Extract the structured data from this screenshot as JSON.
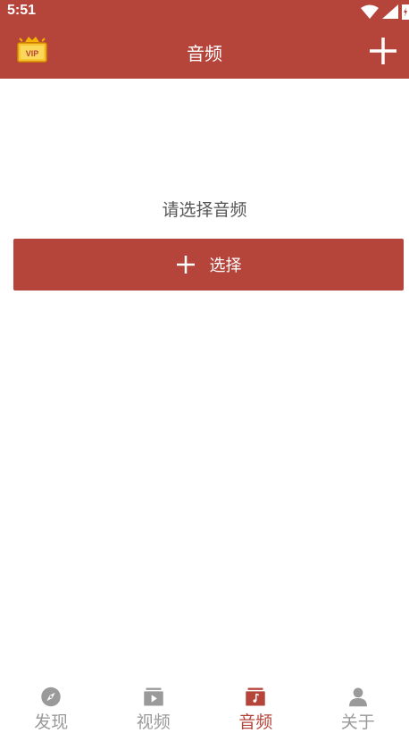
{
  "status": {
    "time": "5:51"
  },
  "header": {
    "title": "音频",
    "vip_badge_text": "VIP",
    "add_icon": "plus-icon"
  },
  "main": {
    "prompt": "请选择音频",
    "select_label": "选择"
  },
  "tabs": [
    {
      "label": "发现",
      "icon": "compass-icon",
      "active": false
    },
    {
      "label": "视频",
      "icon": "video-icon",
      "active": false
    },
    {
      "label": "音频",
      "icon": "music-icon",
      "active": true
    },
    {
      "label": "关于",
      "icon": "person-icon",
      "active": false
    }
  ],
  "colors": {
    "accent": "#b5443b",
    "inactive": "#9a9a9a",
    "vip_gold": "#f5b400"
  }
}
